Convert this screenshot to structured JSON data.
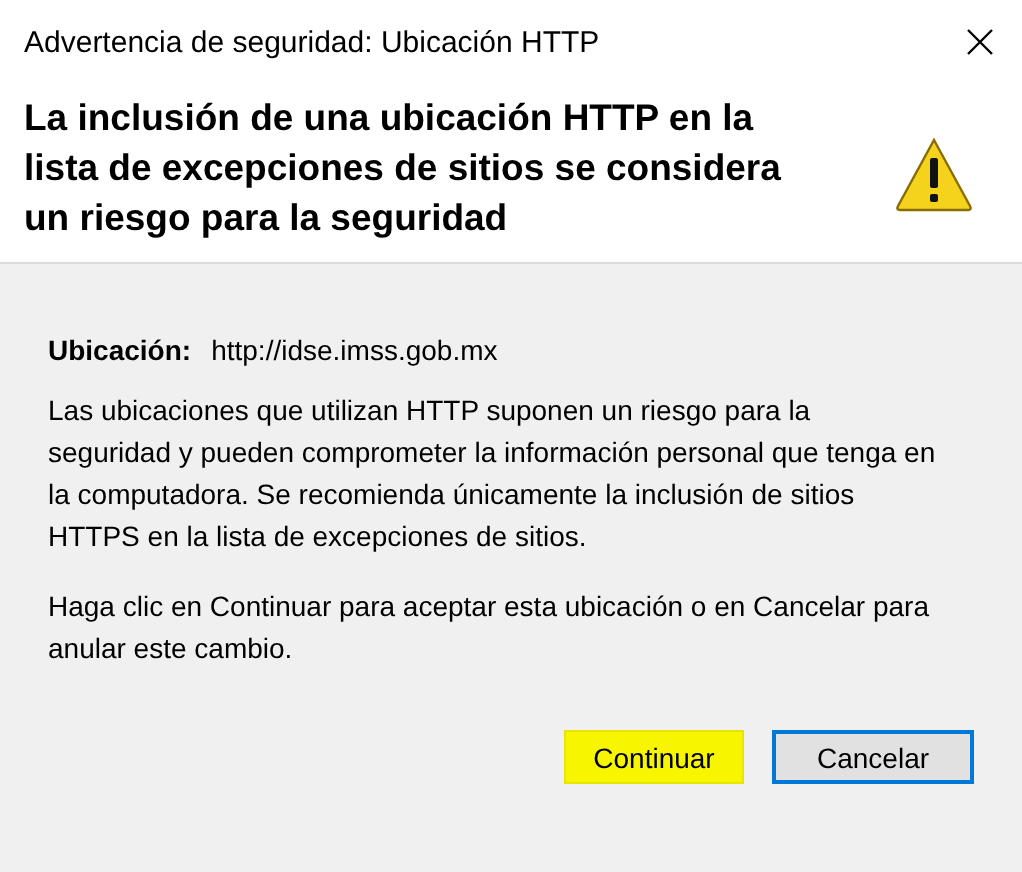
{
  "window": {
    "title": "Advertencia de seguridad: Ubicación HTTP"
  },
  "header": {
    "heading": "La inclusión de una ubicación HTTP en la lista de excepciones de sitios se considera un riesgo para la seguridad"
  },
  "location": {
    "label": "Ubicación:",
    "value": "http://idse.imss.gob.mx"
  },
  "paragraphs": [
    "Las ubicaciones que utilizan HTTP suponen un riesgo para la seguridad y pueden comprometer la información personal que tenga en la computadora. Se recomienda únicamente la inclusión de sitios HTTPS en la lista de excepciones de sitios.",
    "Haga clic en Continuar para aceptar esta ubicación o en Cancelar para anular este cambio."
  ],
  "buttons": [
    {
      "label": "Continuar",
      "highlighted": true,
      "focused": false
    },
    {
      "label": "Cancelar",
      "highlighted": false,
      "focused": true
    }
  ]
}
